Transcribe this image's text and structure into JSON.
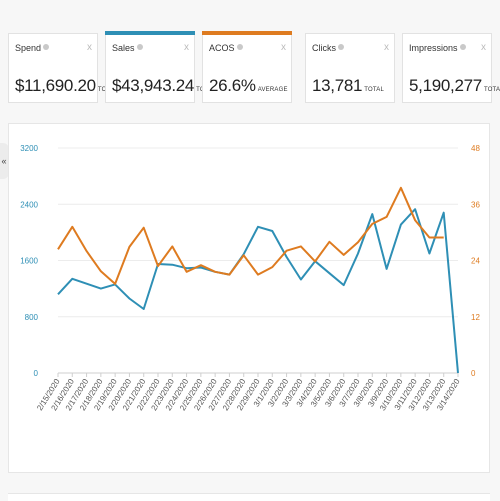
{
  "metrics": [
    {
      "title": "Spend",
      "value": "$11,690.20",
      "unit": "TOTAL",
      "accent": ""
    },
    {
      "title": "Sales",
      "value": "$43,943.24",
      "unit": "TOTAL",
      "accent": "#2e8fb5"
    },
    {
      "title": "ACOS",
      "value": "26.6%",
      "unit": "AVERAGE",
      "accent": "#de7b20"
    },
    {
      "title": "Clicks",
      "value": "13,781",
      "unit": "TOTAL",
      "accent": ""
    },
    {
      "title": "Impressions",
      "value": "5,190,277",
      "unit": "TOTAL",
      "accent": ""
    }
  ],
  "close_glyph": "x",
  "collapse_glyph": "«",
  "chart_data": {
    "type": "line",
    "x": [
      "2/15/2020",
      "2/16/2020",
      "2/17/2020",
      "2/18/2020",
      "2/19/2020",
      "2/20/2020",
      "2/21/2020",
      "2/22/2020",
      "2/23/2020",
      "2/24/2020",
      "2/25/2020",
      "2/26/2020",
      "2/27/2020",
      "2/28/2020",
      "2/29/2020",
      "3/1/2020",
      "3/2/2020",
      "3/3/2020",
      "3/4/2020",
      "3/5/2020",
      "3/6/2020",
      "3/7/2020",
      "3/8/2020",
      "3/9/2020",
      "3/10/2020",
      "3/11/2020",
      "3/12/2020",
      "3/13/2020",
      "3/14/2020"
    ],
    "y_left": {
      "ticks": [
        0,
        800,
        1600,
        2400,
        3200
      ],
      "range": [
        0,
        3200
      ],
      "color": "#2e8fb5"
    },
    "y_right": {
      "ticks": [
        0,
        12,
        24,
        36,
        48
      ],
      "range": [
        0,
        48
      ],
      "color": "#de7b20"
    },
    "series": [
      {
        "name": "Sales",
        "axis": "left",
        "color": "#2e8fb5",
        "values": [
          1120,
          1340,
          1270,
          1200,
          1260,
          1060,
          910,
          1550,
          1540,
          1490,
          1500,
          1440,
          1400,
          1690,
          2080,
          2020,
          1650,
          1330,
          1590,
          1420,
          1250,
          1700,
          2260,
          1480,
          2110,
          2330,
          1700,
          2280,
          0
        ]
      },
      {
        "name": "ACOS",
        "axis": "right",
        "color": "#de7b20",
        "values": [
          26.4,
          31.2,
          26.0,
          21.7,
          19.0,
          26.9,
          31.0,
          22.8,
          27.0,
          21.6,
          23.0,
          21.6,
          21.0,
          25.1,
          21.0,
          22.6,
          26.1,
          27.0,
          23.8,
          28.0,
          25.2,
          27.9,
          31.8,
          33.3,
          39.5,
          32.6,
          28.9,
          28.9
        ]
      }
    ],
    "grid": true,
    "legend": "none"
  }
}
